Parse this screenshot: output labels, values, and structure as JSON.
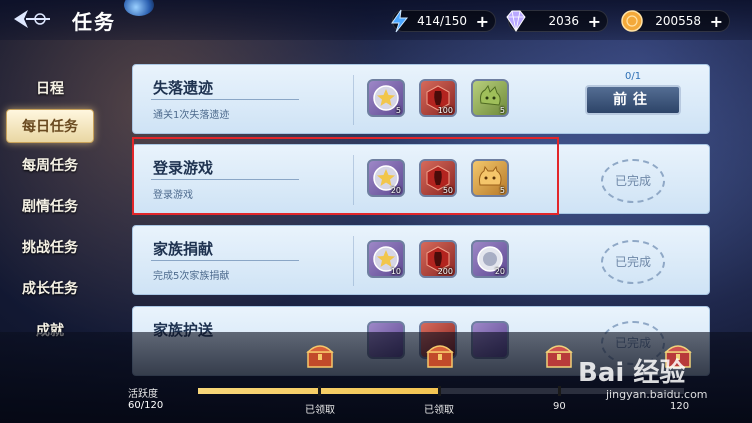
{
  "header": {
    "title": "任务",
    "resources": [
      {
        "icon": "lightning-icon",
        "value": "414/150"
      },
      {
        "icon": "diamond-icon",
        "value": "2036"
      },
      {
        "icon": "coin-icon",
        "value": "200558"
      }
    ],
    "plus": "+"
  },
  "nav": {
    "items": [
      {
        "label": "日程"
      },
      {
        "label": "每日任务",
        "active": true
      },
      {
        "label": "每周任务"
      },
      {
        "label": "剧情任务"
      },
      {
        "label": "挑战任务"
      },
      {
        "label": "成长任务"
      },
      {
        "label": "成就"
      }
    ]
  },
  "tasks": [
    {
      "title": "失落遗迹",
      "desc": "通关1次失落遗迹",
      "rewards": [
        {
          "icon": "star-medal-icon",
          "count": "5"
        },
        {
          "icon": "exp-potion-icon",
          "count": "100"
        },
        {
          "icon": "green-pet-icon",
          "count": "5"
        }
      ],
      "progress": "0/1",
      "action": "前往"
    },
    {
      "title": "登录游戏",
      "desc": "登录游戏",
      "rewards": [
        {
          "icon": "star-medal-icon",
          "count": "20"
        },
        {
          "icon": "exp-potion-icon",
          "count": "50"
        },
        {
          "icon": "gold-pet-icon",
          "count": "5"
        }
      ],
      "status": "已完成"
    },
    {
      "title": "家族捐献",
      "desc": "完成5次家族捐献",
      "rewards": [
        {
          "icon": "star-medal-icon",
          "count": "10"
        },
        {
          "icon": "exp-potion-icon",
          "count": "200"
        },
        {
          "icon": "silver-coin-icon",
          "count": "20"
        }
      ],
      "status": "已完成"
    },
    {
      "title": "家族护送",
      "desc": "",
      "rewards": [],
      "status": "已完成"
    }
  ],
  "activity": {
    "label": "活跃度",
    "value": "60/120",
    "progress_fraction": 0.5,
    "milestones": [
      {
        "label": "已领取",
        "claimed": true
      },
      {
        "label": "已领取",
        "claimed": true
      },
      {
        "label": "90",
        "claimed": false
      },
      {
        "label": "120",
        "claimed": false
      }
    ]
  },
  "watermark": {
    "text": "Bai 经验",
    "sub": "jingyan.baidu.com"
  }
}
